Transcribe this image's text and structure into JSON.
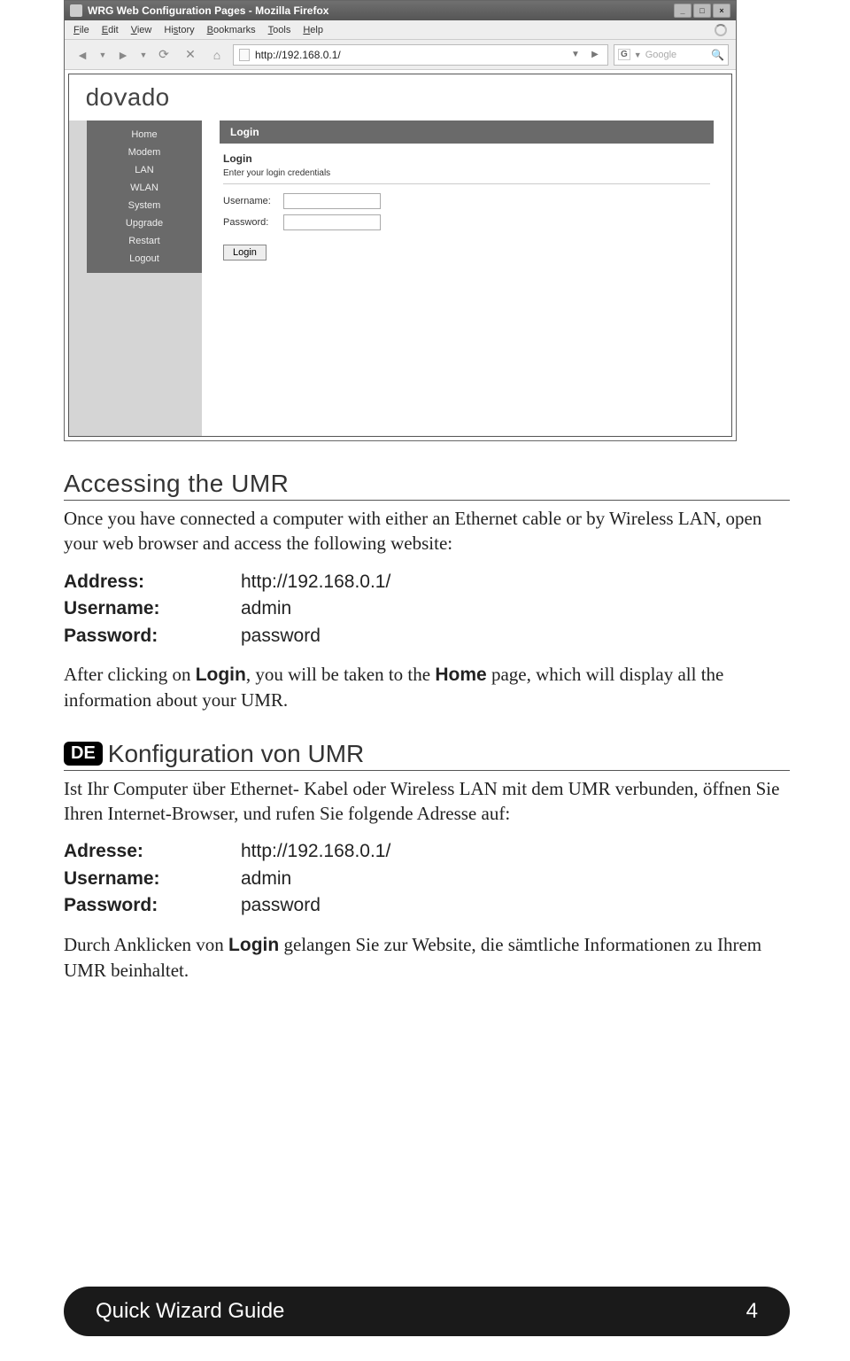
{
  "browser": {
    "title": "WRG Web Configuration Pages - Mozilla Firefox",
    "menus": [
      "File",
      "Edit",
      "View",
      "History",
      "Bookmarks",
      "Tools",
      "Help"
    ],
    "url": "http://192.168.0.1/",
    "search_engine": "G",
    "search_placeholder": "Google"
  },
  "router": {
    "brand": "dovado",
    "nav": [
      "Home",
      "Modem",
      "LAN",
      "WLAN",
      "System",
      "Upgrade",
      "Restart",
      "Logout"
    ],
    "panel_title": "Login",
    "section_title": "Login",
    "section_subtitle": "Enter your login credentials",
    "username_label": "Username:",
    "password_label": "Password:",
    "login_button": "Login"
  },
  "en": {
    "heading": "Accessing the UMR",
    "intro": "Once you have connected a computer with either an Ethernet cable or by Wireless LAN, open your web browser and access the following website:",
    "address_label": "Address:",
    "address_value": "http://192.168.0.1/",
    "username_label": "Username:",
    "username_value": "admin",
    "password_label": "Password:",
    "password_value": "password",
    "after_pre": "After clicking on ",
    "after_bold1": "Login",
    "after_mid": ", you will be taken to the ",
    "after_bold2": "Home",
    "after_post": " page, which will display all the information about your UMR."
  },
  "de": {
    "badge": "DE",
    "heading": "Konfiguration von UMR",
    "intro": "Ist Ihr Computer über Ethernet- Kabel oder Wireless LAN mit dem UMR verbunden, öffnen Sie Ihren Internet-Browser, und rufen Sie folgende Adresse auf:",
    "address_label": "Adresse:",
    "address_value": "http://192.168.0.1/",
    "username_label": "Username:",
    "username_value": "admin",
    "password_label": "Password:",
    "password_value": "password",
    "after_pre": "Durch Anklicken von ",
    "after_bold1": "Login",
    "after_post": " gelangen Sie zur Website, die sämtliche Informationen zu Ihrem UMR beinhaltet."
  },
  "footer": {
    "title": "Quick Wizard Guide",
    "page": "4"
  }
}
